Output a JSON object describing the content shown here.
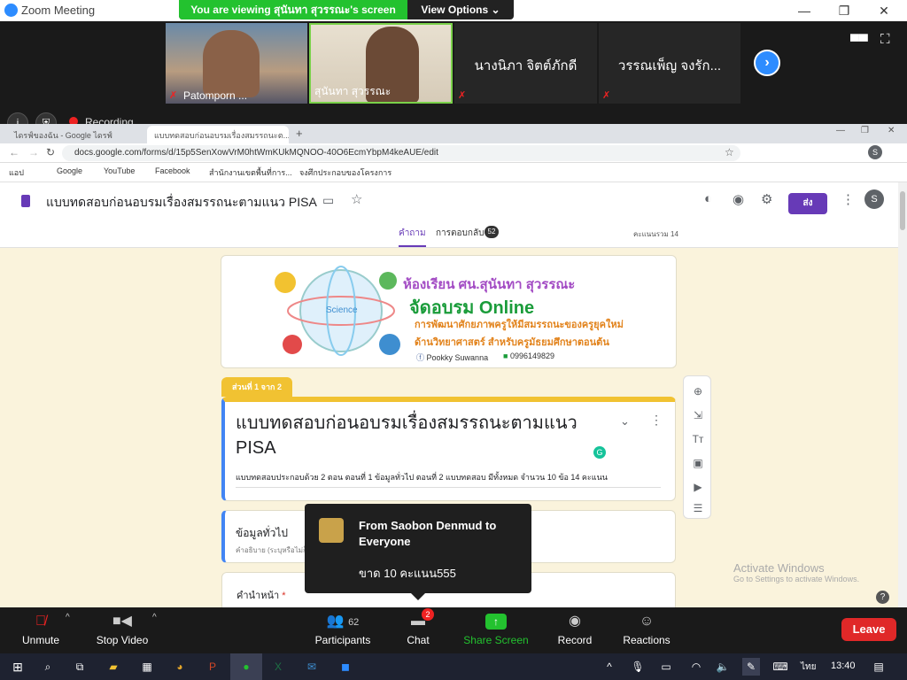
{
  "zoom": {
    "title": "Zoom Meeting",
    "viewing_text": "You are viewing สุนันทา สุวรรณะ's screen",
    "view_options": "View Options",
    "recording": "Recording",
    "participants_tiles": [
      {
        "name": "Patomporn ..."
      },
      {
        "name": "สุนันทา สุวรรณะ"
      },
      {
        "name": "นางนิภา  จิตต์ภักดี"
      },
      {
        "name": "วรรณเพ็ญ  จงรัก..."
      }
    ],
    "controls": {
      "unmute": "Unmute",
      "stop_video": "Stop Video",
      "participants": "Participants",
      "participants_count": "62",
      "chat": "Chat",
      "chat_badge": "2",
      "share_screen": "Share Screen",
      "record": "Record",
      "reactions": "Reactions",
      "leave": "Leave"
    },
    "chat_popup": {
      "from": "From Saobon Denmud to Everyone",
      "message": "ขาด 10 คะแนน555"
    },
    "colors": {
      "accent": "#2d8cff",
      "green": "#23c22f",
      "leave": "#e02828"
    }
  },
  "browser": {
    "tabs": [
      {
        "label": "ไดรฟ์ของฉัน - Google ไดรฟ์"
      },
      {
        "label": "แบบทดสอบก่อนอบรมเรื่องสมรรถนะต..."
      }
    ],
    "url": "docs.google.com/forms/d/15p5SenXowVrM0htWmKUkMQNOO-40O6EcmYbpM4keAUE/edit",
    "bookmarks": [
      "แอป",
      "Google",
      "YouTube",
      "Facebook",
      "สำนักงานเขตพื้นที่การ...",
      "จงศึกประกอบของโครงการ"
    ]
  },
  "form": {
    "title": "แบบทดสอบก่อนอบรมเรื่องสมรรถนะตามแนว PISA",
    "send_label": "ส่ง",
    "avatar": "S",
    "tab_questions": "คำถาม",
    "tab_responses": "การตอบกลับ",
    "responses_count": "52",
    "total_points": "คะแนนรวม 14",
    "banner": {
      "line1": "ห้องเรียน ศน.สุนันทา สุวรรณะ",
      "line2": "จัดอบรม Online",
      "line3": "การพัฒนาศักยภาพครูให้มีสมรรถนะของครูยุคใหม่",
      "line4": "ด้านวิทยาศาสตร์ สำหรับครูมัธยมศึกษาตอนต้น",
      "science": "Science",
      "fb": "Pookky Suwanna",
      "phone": "0996149829"
    },
    "section_badge": "ส่วนที่ 1 จาก 2",
    "section_title": "แบบทดสอบก่อนอบรมเรื่องสมรรถนะตามแนว PISA",
    "section_desc": "แบบทดสอบประกอบด้วย 2 ตอน ตอนที่ 1 ข้อมูลทั่วไป ตอนที่ 2 แบบทดสอบ มีทั้งหมด จำนวน 10 ข้อ 14 คะแนน",
    "q1_title": "ข้อมูลทั่วไป",
    "q1_desc": "คำอธิบาย (ระบุหรือไม่ก็ได้)",
    "q2_title": "คำนำหน้า",
    "q2_required": "*"
  },
  "windows": {
    "activate_title": "Activate Windows",
    "activate_sub": "Go to Settings to activate Windows.",
    "lang": "ไทย",
    "time": "13:40"
  }
}
